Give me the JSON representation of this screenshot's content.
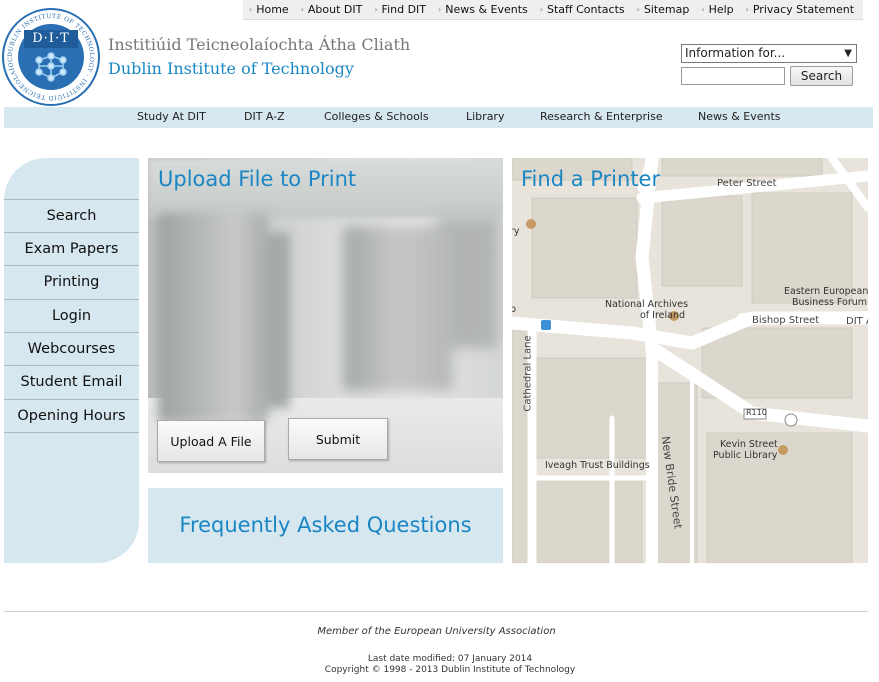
{
  "top_nav": [
    "Home",
    "About DIT",
    "Find DIT",
    "News & Events",
    "Staff Contacts",
    "Sitemap",
    "Help",
    "Privacy Statement"
  ],
  "logo": {
    "abbr": "D·I·T",
    "ring_text": "DUBLIN INSTITUTE OF TECHNOLOGY · INSTITIÚID TEICNEOLAÍOCHTA ÁTHA CLIATH"
  },
  "institute": {
    "irish_name": "Institiúid Teicneolaíochta Átha Cliath",
    "english_name": "Dublin Institute of Technology"
  },
  "header_tools": {
    "info_select_value": "Information for...",
    "search_placeholder": "",
    "search_button": "Search"
  },
  "main_nav": [
    "Study At DIT",
    "DIT A-Z",
    "Colleges & Schools",
    "Library",
    "Research & Enterprise",
    "News & Events"
  ],
  "sidebar": [
    "Search",
    "Exam Papers",
    "Printing",
    "Login",
    "Webcourses",
    "Student Email",
    "Opening Hours"
  ],
  "upload_panel": {
    "title": "Upload File to Print",
    "upload_button": "Upload A File",
    "submit_button": "Submit"
  },
  "faq": {
    "title": "Frequently Asked Questions"
  },
  "map_panel": {
    "title": "Find a Printer",
    "labels": {
      "peter_street": "Peter Street",
      "eastern_european_1": "Eastern European",
      "eastern_european_2": "Business Forum",
      "national_archives_1": "National Archives",
      "national_archives_2": "of Ireland",
      "bishop_street": "Bishop Street",
      "dit_a": "DIT A",
      "cathedral_lane": "Cathedral Lane",
      "r110": "R110",
      "kevin_street_1": "Kevin Street",
      "kevin_street_2": "Public Library",
      "iveagh_trust": "Iveagh Trust Buildings",
      "new_bride_street": "New Bride Street",
      "edge_ry": "ry",
      "edge_b": "b"
    }
  },
  "footer": {
    "member": "Member of the European University Association",
    "last_modified": "Last date modified: 07 January 2014",
    "copyright": "Copyright © 1998 - 2013 Dublin Institute of Technology"
  },
  "colors": {
    "accent_blue": "#1a87c4",
    "panel_bg": "#d6e7ef",
    "logo_blue": "#2a6fb4"
  }
}
